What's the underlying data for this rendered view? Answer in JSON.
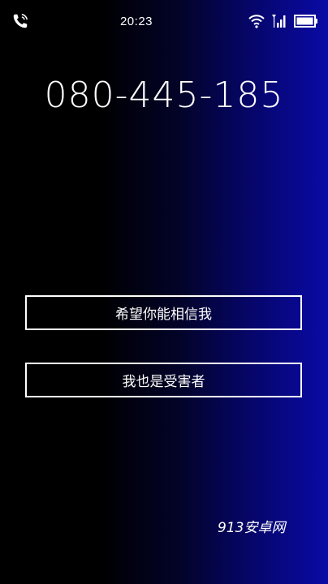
{
  "status_bar": {
    "time": "20:23",
    "left_icon": "phone-call-icon",
    "right_icons": [
      "wifi-icon",
      "signal-icon",
      "battery-icon"
    ]
  },
  "call": {
    "number": "080-445-185"
  },
  "options": [
    {
      "label": "希望你能相信我"
    },
    {
      "label": "我也是受害者"
    }
  ],
  "watermark": "913安卓网",
  "colors": {
    "background_left": "#000000",
    "background_right": "#0a0aa6",
    "text": "#ffffff",
    "button_border": "#ffffff"
  }
}
